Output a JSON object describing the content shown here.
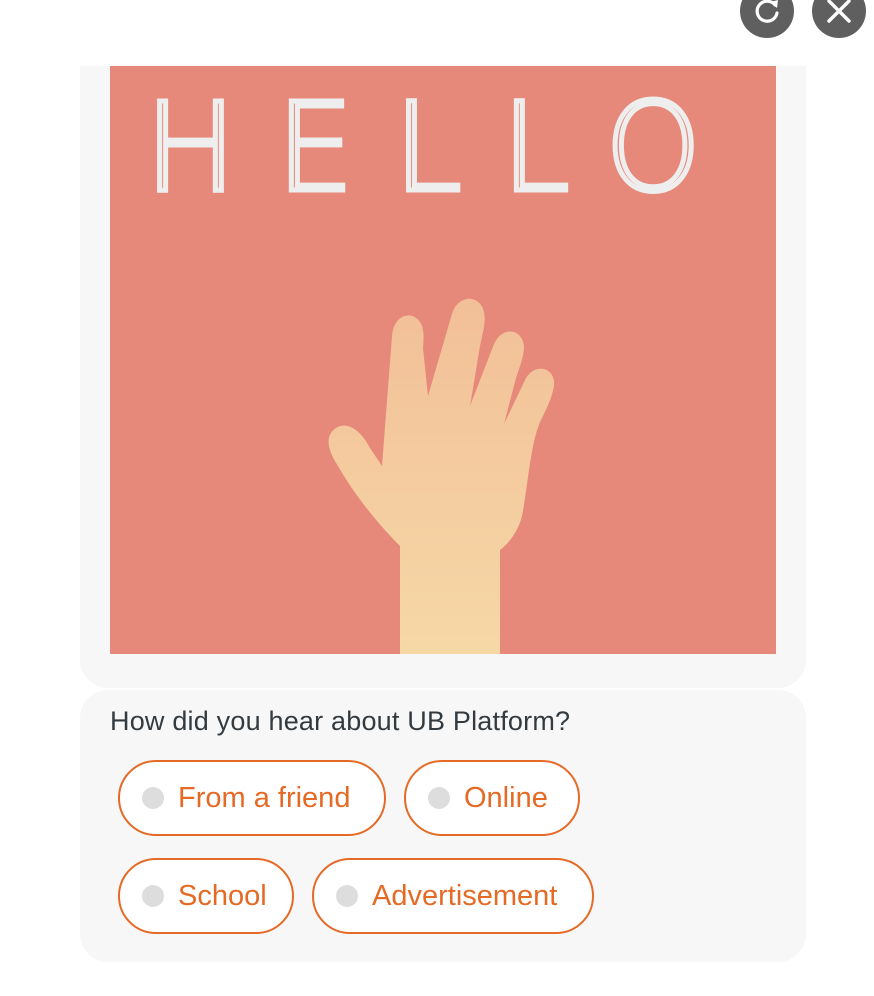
{
  "controls": {
    "refresh_icon": "refresh-icon",
    "close_icon": "close-icon",
    "button_color": "#5f5f5f"
  },
  "image": {
    "text": "HELLO",
    "background_color": "#e6897a",
    "hand_color": "#f5d3a3"
  },
  "question": {
    "text": "How did you hear about UB Platform?",
    "options": [
      {
        "label": "From a friend"
      },
      {
        "label": "Online"
      },
      {
        "label": "School"
      },
      {
        "label": "Advertisement"
      }
    ],
    "accent_color": "#e56a25"
  }
}
